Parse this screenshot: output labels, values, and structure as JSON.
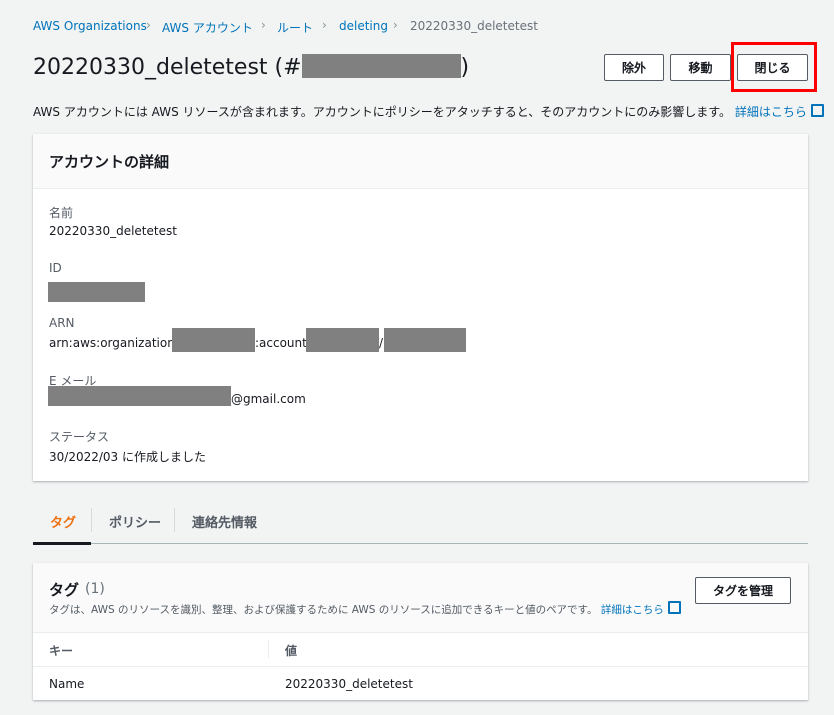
{
  "breadcrumb": [
    "AWS Organizations",
    "AWS アカウント",
    "ルート",
    "deleting",
    "20220330_deletetest"
  ],
  "title": {
    "name": "20220330_deletetest (#",
    ")": ")"
  },
  "buttons": {
    "exclude": "除外",
    "move": "移動",
    "close": "閉じる"
  },
  "description": "AWS アカウントには AWS リソースが含まれます。アカウントにポリシーをアタッチすると、そのアカウントにのみ影響します。",
  "learn_more": "詳細はこちら",
  "details": {
    "header": "アカウントの詳細",
    "name_label": "名前",
    "name_value": "20220330_deletetest",
    "id_label": "ID",
    "arn_label": "ARN",
    "arn_prefix": "arn:aws:organizations::",
    "arn_mid": ":account/o",
    "arn_sep": "/",
    "email_label": "E メール",
    "email_suffix": "@gmail.com",
    "status_label": "ステータス",
    "status_value": "30/2022/03 に作成しました"
  },
  "tabs": [
    "タグ",
    "ポリシー",
    "連絡先情報"
  ],
  "tags": {
    "title": "タグ",
    "count": "(1)",
    "description": "タグは、AWS のリソースを識別、整理、および保護するために AWS のリソースに追加できるキーと値のペアです。",
    "learn_more": "詳細はこちら",
    "manage": "タグを管理",
    "columns": [
      "キー",
      "値"
    ],
    "rows": [
      {
        "key": "Name",
        "value": "20220330_deletetest"
      }
    ]
  },
  "colors": {
    "accent": "#ec7211",
    "link": "#0073bb",
    "highlight": "#ff0000"
  }
}
